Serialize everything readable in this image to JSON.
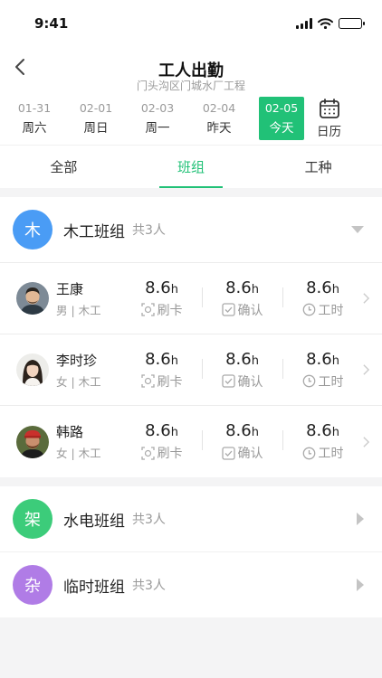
{
  "status": {
    "time": "9:41"
  },
  "header": {
    "title": "工人出勤",
    "subtitle": "门头沟区门城水厂工程"
  },
  "dates": [
    {
      "date": "01-31",
      "weekday": "周六"
    },
    {
      "date": "02-01",
      "weekday": "周日"
    },
    {
      "date": "02-03",
      "weekday": "周一"
    },
    {
      "date": "02-04",
      "weekday": "昨天"
    },
    {
      "date": "02-05",
      "weekday": "今天",
      "active": true
    }
  ],
  "calendar_label": "日历",
  "tabs": [
    {
      "label": "全部"
    },
    {
      "label": "班组",
      "active": true
    },
    {
      "label": "工种"
    }
  ],
  "groups": [
    {
      "avatar_char": "木",
      "name": "木工班组",
      "count": "共3人",
      "color": "#4a9cf5",
      "expanded": true,
      "workers": [
        {
          "name": "王康",
          "meta": "男 | 木工",
          "stats": [
            {
              "value": "8.6",
              "unit": "h",
              "label": "刷卡"
            },
            {
              "value": "8.6",
              "unit": "h",
              "label": "确认"
            },
            {
              "value": "8.6",
              "unit": "h",
              "label": "工时"
            }
          ]
        },
        {
          "name": "李时珍",
          "meta": "女 | 木工",
          "stats": [
            {
              "value": "8.6",
              "unit": "h",
              "label": "刷卡"
            },
            {
              "value": "8.6",
              "unit": "h",
              "label": "确认"
            },
            {
              "value": "8.6",
              "unit": "h",
              "label": "工时"
            }
          ]
        },
        {
          "name": "韩路",
          "meta": "女 | 木工",
          "stats": [
            {
              "value": "8.6",
              "unit": "h",
              "label": "刷卡"
            },
            {
              "value": "8.6",
              "unit": "h",
              "label": "确认"
            },
            {
              "value": "8.6",
              "unit": "h",
              "label": "工时"
            }
          ]
        }
      ]
    },
    {
      "avatar_char": "架",
      "name": "水电班组",
      "count": "共3人",
      "color": "#3ccc7a",
      "expanded": false
    },
    {
      "avatar_char": "杂",
      "name": "临时班组",
      "count": "共3人",
      "color": "#b07ce6",
      "expanded": false
    }
  ],
  "colors": {
    "accent": "#21c177"
  }
}
